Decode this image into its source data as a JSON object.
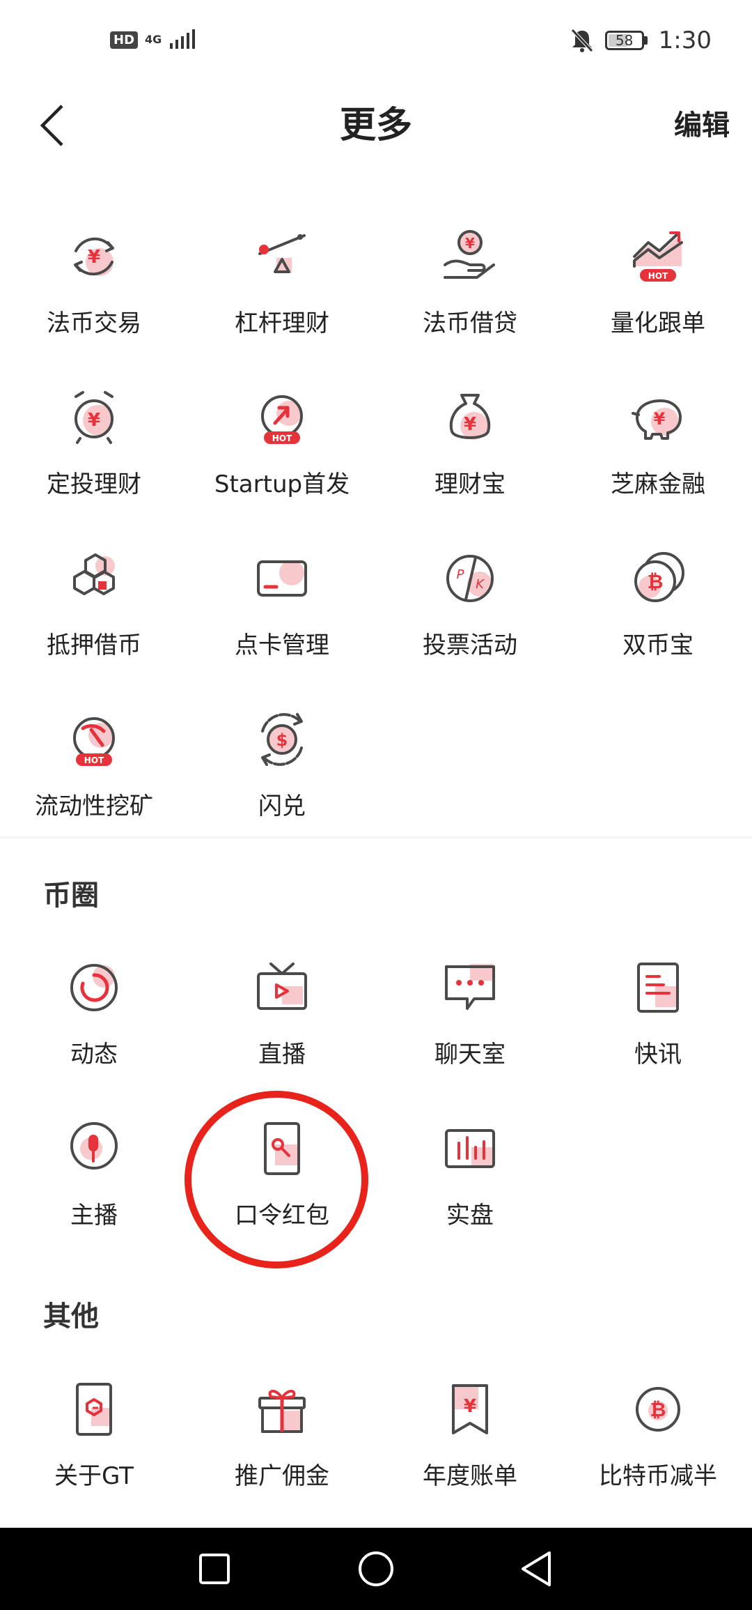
{
  "status_bar": {
    "hd": "HD",
    "network": "4G",
    "battery": "58",
    "battery_level": 0.58,
    "time": "1:30"
  },
  "header": {
    "back_icon": "chevron-left-icon",
    "title": "更多",
    "edit_label": "编辑"
  },
  "main_grid": [
    {
      "label": "法币交易",
      "icon": "yuan-exchange-icon"
    },
    {
      "label": "杠杆理财",
      "icon": "leverage-scale-icon"
    },
    {
      "label": "法币借贷",
      "icon": "hand-coin-icon"
    },
    {
      "label": "量化跟单",
      "icon": "trend-hot-icon",
      "badge": "HOT"
    },
    {
      "label": "定投理财",
      "icon": "alarm-clock-yuan-icon"
    },
    {
      "label": "Startup首发",
      "icon": "startup-hot-icon",
      "badge": "HOT"
    },
    {
      "label": "理财宝",
      "icon": "money-bag-icon"
    },
    {
      "label": "芝麻金融",
      "icon": "piggy-bank-icon"
    },
    {
      "label": "抵押借币",
      "icon": "cubes-icon"
    },
    {
      "label": "点卡管理",
      "icon": "card-icon"
    },
    {
      "label": "投票活动",
      "icon": "pk-vote-icon"
    },
    {
      "label": "双币宝",
      "icon": "bitcoin-coins-icon"
    },
    {
      "label": "流动性挖矿",
      "icon": "mining-hot-icon",
      "badge": "HOT"
    },
    {
      "label": "闪兑",
      "icon": "dollar-swap-icon"
    }
  ],
  "coin_circle": {
    "title": "币圈",
    "items": [
      {
        "label": "动态",
        "icon": "refresh-circle-icon"
      },
      {
        "label": "直播",
        "icon": "tv-play-icon"
      },
      {
        "label": "聊天室",
        "icon": "chat-bubble-icon"
      },
      {
        "label": "快讯",
        "icon": "news-doc-icon"
      },
      {
        "label": "主播",
        "icon": "anchor-pin-icon"
      },
      {
        "label": "口令红包",
        "icon": "key-envelope-icon"
      },
      {
        "label": "实盘",
        "icon": "bar-chart-icon"
      }
    ]
  },
  "other": {
    "title": "其他",
    "items": [
      {
        "label": "关于GT",
        "icon": "gt-phone-icon"
      },
      {
        "label": "推广佣金",
        "icon": "gift-icon"
      },
      {
        "label": "年度账单",
        "icon": "bookmark-yuan-icon"
      },
      {
        "label": "比特币减半",
        "icon": "bitcoin-circle-icon"
      }
    ]
  },
  "colors": {
    "accent": "#e5323b",
    "pink": "#f7c9cc",
    "stroke": "#4a4a4a",
    "annotation": "#e8231b"
  },
  "nav": {
    "recent": "square-icon",
    "home": "circle-icon",
    "back": "triangle-back-icon"
  }
}
